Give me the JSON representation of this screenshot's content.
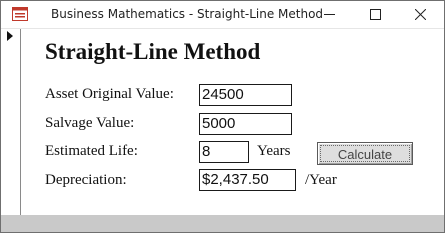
{
  "window": {
    "title": "Business Mathematics - Straight-Line Method"
  },
  "form": {
    "heading": "Straight-Line Method",
    "asset_original_value": {
      "label": "Asset Original Value:",
      "value": "24500"
    },
    "salvage_value": {
      "label": "Salvage Value:",
      "value": "5000"
    },
    "estimated_life": {
      "label": "Estimated Life:",
      "value": "8",
      "unit": "Years"
    },
    "depreciation": {
      "label": "Depreciation:",
      "value": "$2,437.50",
      "unit": "/Year"
    },
    "calculate_label": "Calculate"
  },
  "icons": {
    "app": "access-form-icon",
    "minimize": "minimize-icon",
    "maximize": "maximize-icon",
    "close": "close-icon",
    "record_selector": "record-selector-arrow-icon"
  },
  "colors": {
    "window_border": "#6f6f6f",
    "app_icon": "#c0392b",
    "button_face": "#dedede",
    "bottom_band": "#c9c9c9"
  }
}
